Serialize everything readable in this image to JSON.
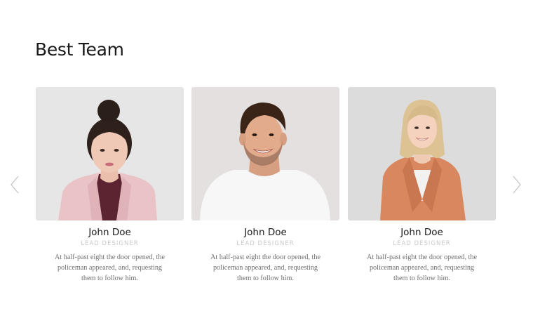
{
  "section": {
    "title": "Best Team"
  },
  "carousel": {
    "prev_icon": "chevron-left-icon",
    "next_icon": "chevron-right-icon"
  },
  "team": [
    {
      "name": "John Doe",
      "role": "LEAD DESIGNER",
      "bio": "At half-past eight the door opened, the policeman appeared, and, requesting them to follow him.",
      "photo": "woman-in-pink-blazer-portrait",
      "photo_bg": "#e6e6e7"
    },
    {
      "name": "John Doe",
      "role": "LEAD DESIGNER",
      "bio": "At half-past eight the door opened, the policeman appeared, and, requesting them to follow him.",
      "photo": "man-in-white-tshirt-portrait",
      "photo_bg": "#e5e0e0"
    },
    {
      "name": "John Doe",
      "role": "LEAD DESIGNER",
      "bio": "At half-past eight the door opened, the policeman appeared, and, requesting them to follow him.",
      "photo": "woman-in-orange-blazer-portrait",
      "photo_bg": "#dcdcdc"
    }
  ]
}
